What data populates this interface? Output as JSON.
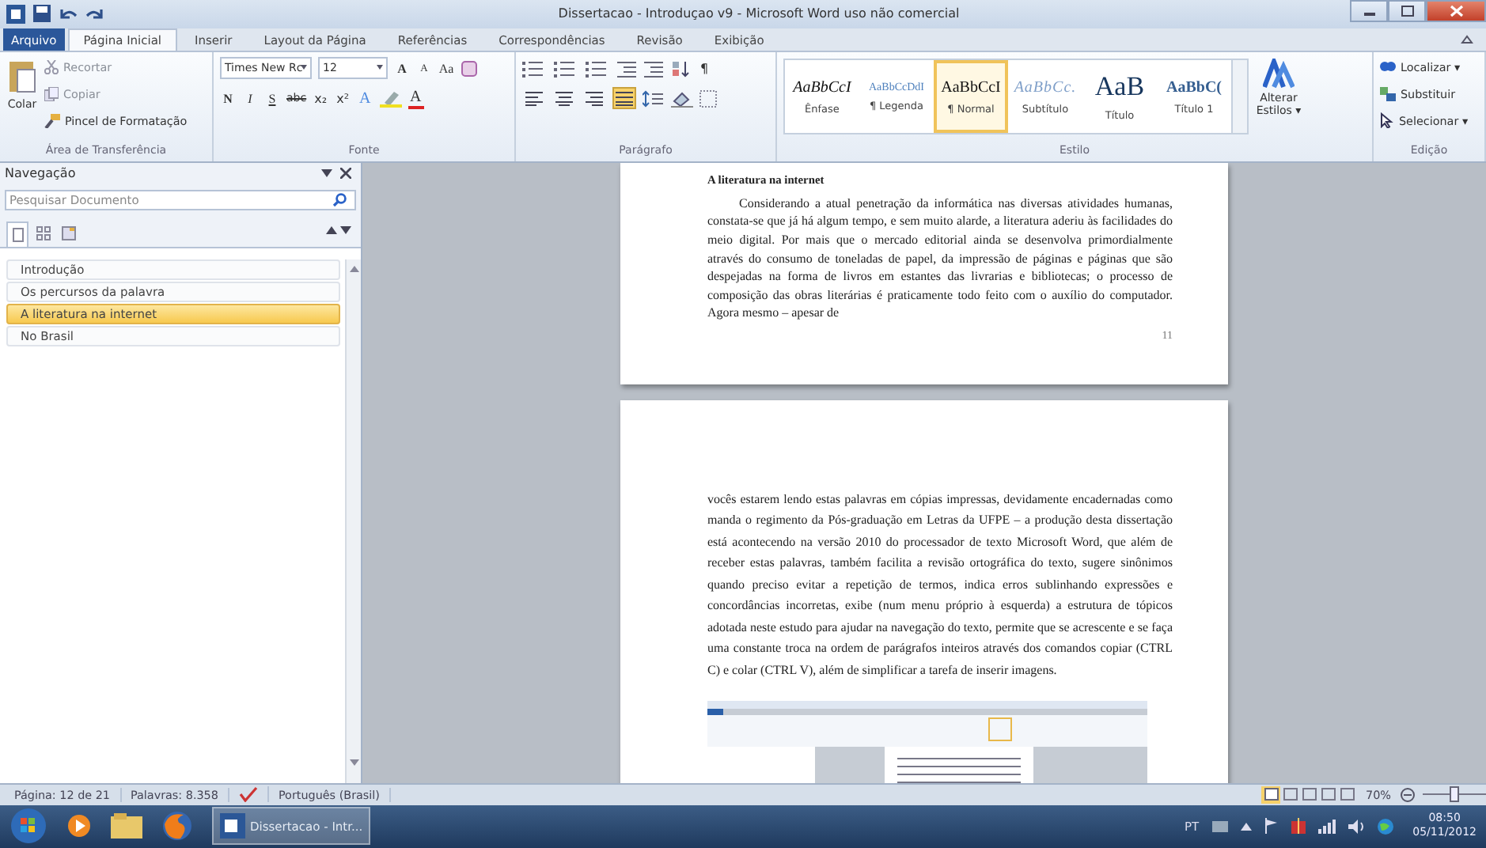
{
  "window": {
    "title": "Dissertacao - Introduçao v9 - Microsoft Word uso não comercial"
  },
  "tabs": [
    {
      "label": "Arquivo",
      "kind": "file",
      "selected": false
    },
    {
      "label": "Página Inicial",
      "kind": "tab",
      "selected": true
    },
    {
      "label": "Inserir",
      "kind": "tab",
      "selected": false
    },
    {
      "label": "Layout da Página",
      "kind": "tab",
      "selected": false
    },
    {
      "label": "Referências",
      "kind": "tab",
      "selected": false
    },
    {
      "label": "Correspondências",
      "kind": "tab",
      "selected": false
    },
    {
      "label": "Revisão",
      "kind": "tab",
      "selected": false
    },
    {
      "label": "Exibição",
      "kind": "tab",
      "selected": false
    }
  ],
  "clipboard": {
    "label": "Área de Transferência",
    "paste": "Colar",
    "cut": "Recortar",
    "copy": "Copiar",
    "format_painter": "Pincel de Formatação"
  },
  "font": {
    "label": "Fonte",
    "name": "Times New Rc",
    "size": "12",
    "grow": "A",
    "shrink": "A",
    "case": "Aa",
    "bold": "N",
    "italic": "I",
    "underline": "S",
    "strike": "abc",
    "subscript": "x₂",
    "superscript": "x²",
    "effects": "A",
    "color_button": "A"
  },
  "paragraph": {
    "label": "Parágrafo",
    "marks": "¶",
    "align": [
      {
        "selected": false
      },
      {
        "selected": false
      },
      {
        "selected": false
      },
      {
        "selected": true
      }
    ]
  },
  "styles": {
    "label": "Estilo",
    "change": "Alterar Estilos ▾",
    "items": [
      {
        "sample": "AaBbCcI",
        "name": "Ênfase",
        "kind": "emphasis",
        "selected": false
      },
      {
        "sample": "AaBbCcDdI",
        "name": "¶ Legenda",
        "kind": "caption",
        "selected": false
      },
      {
        "sample": "AaBbCcI",
        "name": "¶ Normal",
        "kind": "normal",
        "selected": true
      },
      {
        "sample": "AaBbCc.",
        "name": "Subtítulo",
        "kind": "subtitle",
        "selected": false
      },
      {
        "sample": "AaB",
        "name": "Título",
        "kind": "title",
        "selected": false
      },
      {
        "sample": "AaBbC(",
        "name": "Título 1",
        "kind": "heading",
        "selected": false
      }
    ]
  },
  "editing": {
    "label": "Edição",
    "find": "Localizar ▾",
    "replace": "Substituir",
    "select": "Selecionar ▾"
  },
  "navigation": {
    "title": "Navegação",
    "search": {
      "placeholder": "Pesquisar Documento"
    },
    "view_tabs": [
      {
        "selected": true
      },
      {
        "selected": false
      },
      {
        "selected": false
      }
    ],
    "headings": [
      {
        "label": "Introdução",
        "selected": false
      },
      {
        "label": "Os percursos da palavra",
        "selected": false
      },
      {
        "label": "A literatura na internet",
        "selected": true
      },
      {
        "label": "No Brasil",
        "selected": false
      }
    ]
  },
  "pages": [
    {
      "heading": "A literatura na internet",
      "paragraph": "Considerando a atual penetração da informática nas diversas atividades humanas, constata-se que já há algum tempo, e sem muito alarde, a literatura aderiu às facilidades do meio digital. Por mais que o mercado editorial ainda se desenvolva primordialmente através do consumo de toneladas de papel, da impressão de páginas e páginas que são despejadas na forma de livros em estantes das livrarias e bibliotecas; o processo de composição das obras literárias é praticamente todo feito com o auxílio do computador. Agora mesmo – apesar de",
      "page_number": "11"
    },
    {
      "paragraph": "vocês estarem lendo estas palavras em cópias impressas, devidamente encadernadas como manda o regimento da Pós-graduação em Letras da UFPE – a produção desta dissertação está acontecendo na versão 2010 do processador de texto Microsoft Word, que além de receber estas palavras, também facilita a revisão ortográfica do texto, sugere sinônimos quando preciso evitar a repetição de termos, indica erros sublinhando expressões e concordâncias incorretas, exibe (num menu próprio à esquerda) a estrutura de tópicos adotada neste estudo para ajudar na navegação do texto, permite que se acrescente e se faça uma constante troca na ordem de parágrafos inteiros através dos comandos copiar (CTRL C) e colar (CTRL V), além de simplificar a tarefa de inserir imagens."
    }
  ],
  "status_bar": {
    "page": "Página: 12 de 21",
    "words": "Palavras: 8.358",
    "language": "Português (Brasil)",
    "zoom": "70%",
    "zoom_slider": {
      "level": 0.5
    }
  },
  "taskbar": {
    "window": "Dissertacao - Intr...",
    "language": "PT",
    "time": "08:50",
    "date": "05/11/2012"
  }
}
